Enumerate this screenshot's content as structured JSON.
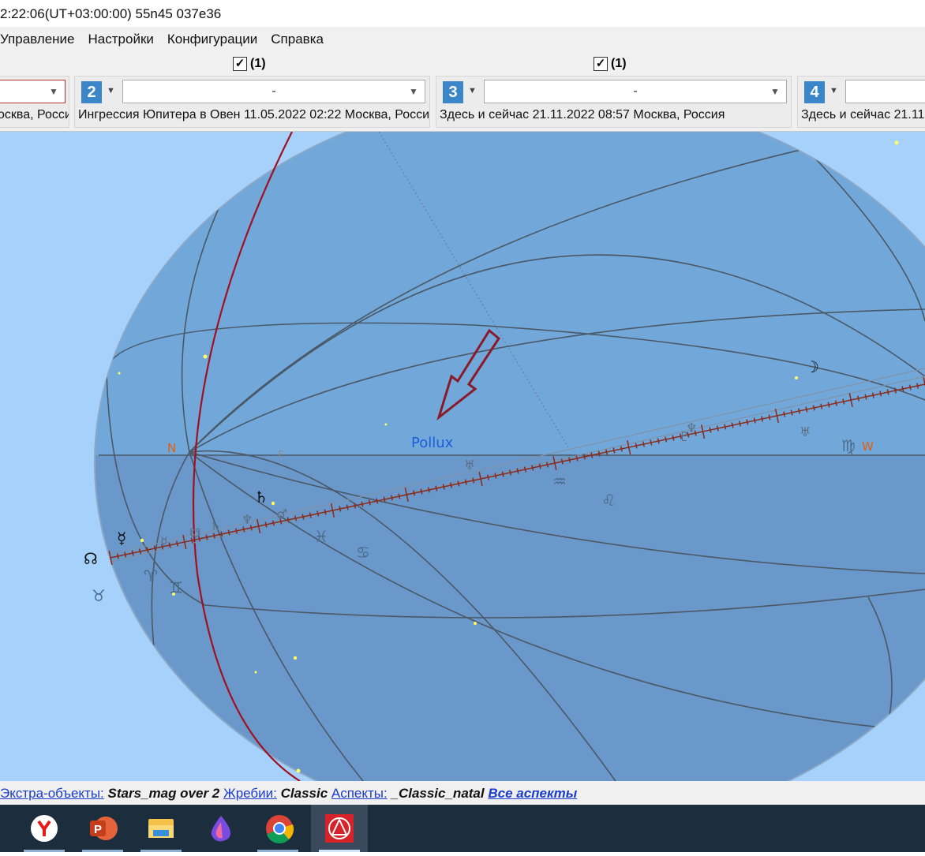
{
  "window": {
    "title": "2:22:06(UT+03:00:00) 55n45 037e36"
  },
  "menu": {
    "items": [
      "Управление",
      "Настройки",
      "Конфигурации",
      "Справка"
    ]
  },
  "panels": {
    "check_headers": [
      {
        "checked": "✓",
        "label": "(1)"
      },
      {
        "checked": "✓",
        "label": "(1)"
      }
    ],
    "items": [
      {
        "number": "",
        "selected": "",
        "description": "осква, Росси"
      },
      {
        "number": "2",
        "selected": "-",
        "description": "Ингрессия Юпитера в Овен 11.05.2022 02:22 Москва, Росси"
      },
      {
        "number": "3",
        "selected": "-",
        "description": "Здесь и сейчас 21.11.2022 08:57 Москва, Россия"
      },
      {
        "number": "4",
        "selected": "",
        "description": "Здесь и сейчас 21.11."
      }
    ]
  },
  "sky": {
    "labels": {
      "north": "N",
      "west": "W",
      "faint_mark": "F",
      "star": "Pollux"
    },
    "colors": {
      "background": "#a6d1fb",
      "sphere": "#6f9fcf",
      "meridian": "#a01020",
      "ecliptic": "#8a2a1a",
      "arrow": "#8a1a2a",
      "cardinal": "#e06010",
      "star_label": "#1a5ed8"
    },
    "glyphs": {
      "zodiac": [
        "♈",
        "♉",
        "♊",
        "♋",
        "♌",
        "♍",
        "♒",
        "♓"
      ],
      "planets_dark": [
        "☽",
        "☿",
        "♄",
        "☊"
      ],
      "planets_pale": [
        "♄",
        "♆",
        "♂",
        "♅",
        "♆",
        "☿",
        "♅",
        "♇",
        "☋"
      ]
    }
  },
  "status": {
    "extra_label": "Экстра-объекты:",
    "extra_value": "Stars_mag over 2",
    "lots_label": "Жребии:",
    "lots_value": "Classic",
    "aspects_label": "Аспекты:",
    "aspects_value": "_Classic_natal",
    "all_aspects": "Все аспекты"
  },
  "taskbar": {
    "apps": [
      "yandex-browser",
      "powerpoint",
      "file-explorer",
      "paint-app",
      "chrome",
      "astro-app"
    ]
  }
}
